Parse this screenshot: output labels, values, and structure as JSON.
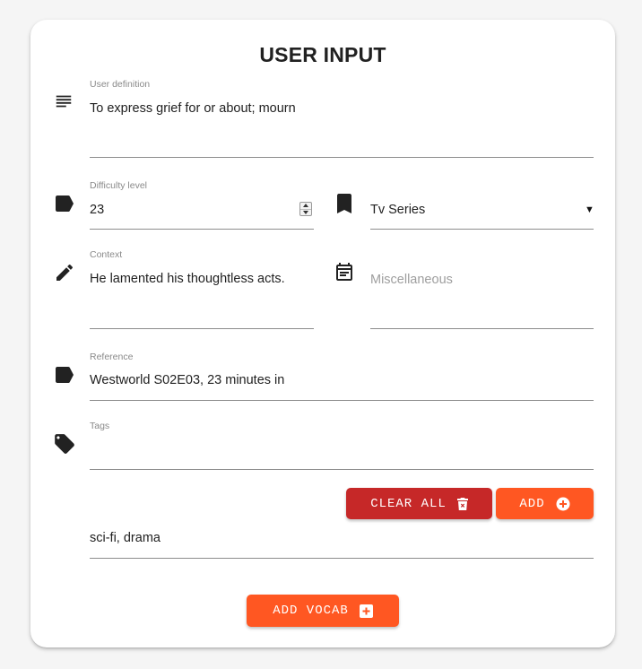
{
  "form": {
    "title": "USER INPUT",
    "definition": {
      "label": "User definition",
      "value": "To express grief for or about; mourn",
      "icon": "notes-icon"
    },
    "difficulty": {
      "label": "Difficulty level",
      "value": "23",
      "icon": "label-icon"
    },
    "media_type": {
      "value": "Tv Series",
      "icon": "bookmark-icon"
    },
    "context": {
      "label": "Context",
      "value": "He lamented his thoughtless acts.",
      "icon": "pencil-icon"
    },
    "miscellaneous": {
      "placeholder": "Miscellaneous",
      "icon": "calendar-icon"
    },
    "reference": {
      "label": "Reference",
      "value": "Westworld S02E03, 23 minutes in",
      "icon": "label-icon"
    },
    "tags": {
      "label": "Tags",
      "value": "",
      "icon": "tag-icon",
      "list": "sci-fi, drama"
    },
    "buttons": {
      "clear_all": "CLEAR ALL",
      "add": "ADD",
      "add_vocab": "ADD VOCAB"
    },
    "colors": {
      "clear_all": "#c62828",
      "accent": "#ff5722"
    }
  }
}
